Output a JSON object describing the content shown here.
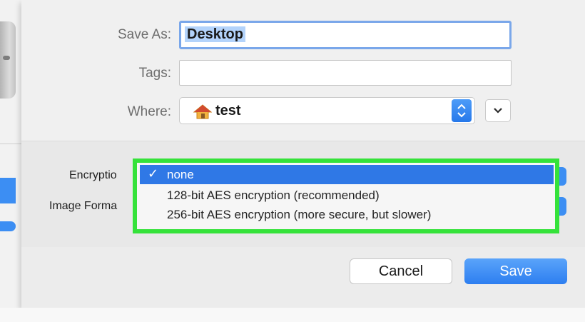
{
  "form": {
    "save_as_label": "Save As:",
    "save_as_value": "Desktop",
    "tags_label": "Tags:",
    "tags_value": "",
    "where_label": "Where:",
    "where_value": "test",
    "where_icon": "home-icon",
    "expand_icon": "chevron-down-icon"
  },
  "options": {
    "encryption_label": "Encryptio",
    "image_format_label": "Image Forma"
  },
  "dropdown": {
    "selected_check": "✓",
    "items": [
      {
        "label": "none",
        "selected": true
      },
      {
        "label": "128-bit AES encryption (recommended)",
        "selected": false
      },
      {
        "label": "256-bit AES encryption (more secure, but slower)",
        "selected": false
      }
    ],
    "highlight_color": "#35e23a"
  },
  "buttons": {
    "cancel_label": "Cancel",
    "save_label": "Save"
  },
  "colors": {
    "accent": "#2f78e6"
  }
}
